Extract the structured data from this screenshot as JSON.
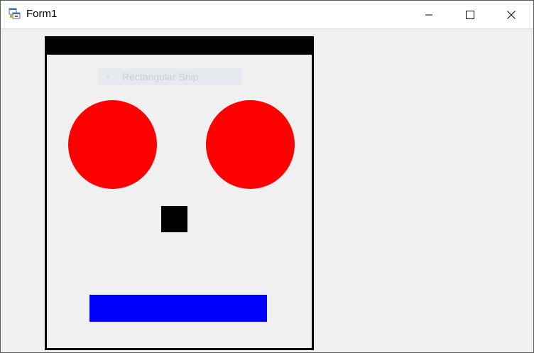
{
  "window": {
    "title": "Form1",
    "icon": "winforms-app-icon",
    "controls": {
      "minimize_icon": "minimize-icon",
      "maximize_icon": "maximize-icon",
      "close_icon": "close-icon"
    }
  },
  "overlay": {
    "label": "Rectangular Snip",
    "icon": "radio-icon"
  },
  "colors": {
    "frame": "#000000",
    "eyes": "#ff0000",
    "nose": "#000000",
    "mouth": "#0000ff",
    "background": "#f0f0f0"
  }
}
